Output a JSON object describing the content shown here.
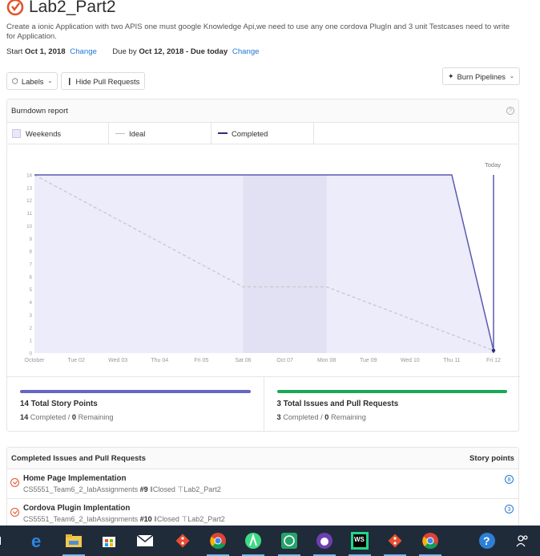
{
  "milestone": {
    "title": "Lab2_Part2",
    "description": "Create a ionic Application with two APIS one must google Knowledge Api,we need to use any one cordova PlugIn and 3 unit Testcases need to write for Application.",
    "start_label": "Start",
    "start_date": "Oct 1, 2018",
    "change_label": "Change",
    "due_label": "Due by",
    "due_date": "Oct 12, 2018 - Due today"
  },
  "toolbar": {
    "labels_button": "Labels",
    "hide_pr_button": "Hide Pull Requests",
    "burn_pipelines_button": "Burn Pipelines"
  },
  "burndown": {
    "header": "Burndown report",
    "help": "?",
    "legend": {
      "weekends": "Weekends",
      "ideal": "Ideal",
      "completed": "Completed"
    },
    "today_label": "Today"
  },
  "chart_data": {
    "type": "line",
    "x": [
      "October",
      "Tue 02",
      "Wed 03",
      "Thu 04",
      "Fri 05",
      "Sat 06",
      "Oct 07",
      "Mon 08",
      "Tue 09",
      "Wed 10",
      "Thu 11",
      "Fri 12"
    ],
    "y_ticks": [
      0,
      1,
      2,
      3,
      4,
      5,
      6,
      7,
      8,
      9,
      10,
      11,
      12,
      13,
      14
    ],
    "ylim": [
      0,
      14
    ],
    "weekend_range": [
      "Sat 06",
      "Mon 08"
    ],
    "series": [
      {
        "name": "Ideal",
        "values": [
          14,
          null,
          null,
          null,
          null,
          5.2,
          null,
          5.2,
          null,
          null,
          null,
          0.2
        ],
        "style": "dashed",
        "color": "#c6c6c6"
      },
      {
        "name": "Completed",
        "values": [
          14,
          14,
          14,
          14,
          14,
          14,
          14,
          14,
          14,
          14,
          14,
          0.2
        ],
        "style": "solid",
        "color": "#5a5ab0"
      }
    ],
    "grid": false,
    "legend_position": "top"
  },
  "stats": {
    "story_points": {
      "title": "14 Total Story Points",
      "completed": "14",
      "completed_label": "Completed",
      "remaining": "0",
      "remaining_label": "Remaining",
      "color": "#6666c4"
    },
    "issues": {
      "title": "3 Total Issues and Pull Requests",
      "completed": "3",
      "completed_label": "Completed",
      "remaining": "0",
      "remaining_label": "Remaining",
      "color": "#1aaa55"
    }
  },
  "issues_panel": {
    "header": "Completed Issues and Pull Requests",
    "points_header": "Story points",
    "items": [
      {
        "title": "Home Page Implementation",
        "repo": "CS5551_Team6_2_labAssignments",
        "number": "#9",
        "state": "Closed",
        "milestone": "Lab2_Part2",
        "points": "8"
      },
      {
        "title": "Cordova Plugin Implentation",
        "repo": "CS5551_Team6_2_labAssignments",
        "number": "#10",
        "state": "Closed",
        "milestone": "Lab2_Part2",
        "points": "3"
      }
    ]
  },
  "taskbar": {
    "items": [
      "edge-icon",
      "file-explorer-icon",
      "store-icon",
      "mail-icon",
      "git-icon",
      "chrome-icon",
      "android-studio-icon",
      "whatsapp-icon",
      "github-desktop-icon",
      "webstorm-icon",
      "git-icon",
      "chrome-icon",
      "help-icon",
      "people-icon"
    ]
  }
}
